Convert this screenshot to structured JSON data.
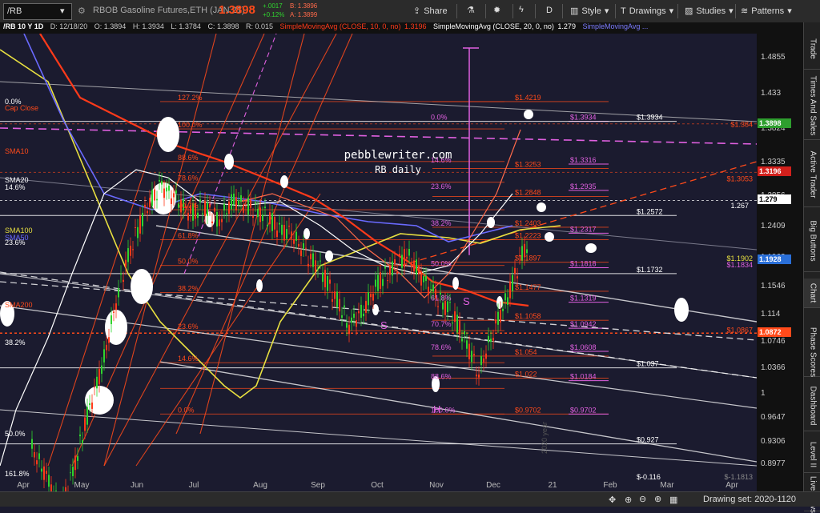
{
  "toolbar": {
    "symbol": "/RB",
    "title": "RBOB Gasoline Futures,ETH (JAN 21)",
    "last": "1.3898",
    "change": "+.0017",
    "change_pct": "+0.12%",
    "bid": "B: 1.3896",
    "ask": "A: 1.3899",
    "share": "Share",
    "period": "D",
    "style": "Style",
    "drawings": "Drawings",
    "studies": "Studies",
    "patterns": "Patterns"
  },
  "header": {
    "symbol_period": "/RB 10 Y 1D",
    "date": "D: 12/18/20",
    "open": "O: 1.3894",
    "high": "H: 1.3934",
    "low": "L: 1.3784",
    "close": "C: 1.3898",
    "range": "R: 0.015",
    "sma10": "SimpleMovingAvg (CLOSE, 10, 0, no)",
    "sma10_val": "1.3196",
    "sma20": "SimpleMovingAvg (CLOSE, 20, 0, no)",
    "sma20_val": "1.279",
    "sma_more": "SimpleMovingAvg ..."
  },
  "price_axis": {
    "ticks": [
      "1.4855",
      "1.433",
      "1.3824",
      "1.3335",
      "1.2856",
      "1.2409",
      "1.1963",
      "1.1546",
      "1.114",
      "1.0746",
      "1.0366",
      "1",
      "0.9647",
      "0.9306",
      "0.8977"
    ],
    "badges": [
      {
        "label": "1.3898",
        "color": "#2e9e2e"
      },
      {
        "label": "1.3196",
        "color": "#d2201c"
      },
      {
        "label": "1.279",
        "color": "#ffffff"
      },
      {
        "label": "1.1928",
        "color": "#2a6fd8"
      },
      {
        "label": "1.0872",
        "color": "#ff4a1a"
      }
    ]
  },
  "x_axis": [
    "Apr",
    "May",
    "Jun",
    "Jul",
    "Aug",
    "Sep",
    "Oct",
    "Nov",
    "Dec",
    "21",
    "Feb",
    "Mar",
    "Apr"
  ],
  "watermark": [
    "pebblewriter.com",
    "RB daily"
  ],
  "year_tag": "2020 year",
  "left_labels": {
    "top": "0.0%",
    "cap": "Cap Close",
    "sma10": "SMA10",
    "sma20": "SMA20",
    "fib146": "14.6%",
    "sma100": "SMA100",
    "sma50": "SMA50",
    "fib236": "23.6%",
    "sma200": "SMA200",
    "fib382": "38.2%",
    "fib50": "50.0%",
    "fib1618": "161.8%"
  },
  "fib_left_pct": [
    "127.2%",
    "100.0%",
    "88.6%",
    "78.6%",
    "70.7%",
    "61.8%",
    "50.0%",
    "38.2%",
    "23.6%",
    "14.6%",
    "0.0%"
  ],
  "fib_mid": {
    "pct": [
      "0.0%",
      "14.6%",
      "23.6%",
      "38.2%",
      "50.0%",
      "61.8%",
      "70.7%",
      "78.6%",
      "88.6%",
      "100.0%"
    ],
    "vals": [
      "$1.4219",
      "$1.3253",
      "$1.2848",
      "$1.2403",
      "$1.2223",
      "$1.1897",
      "$1.1477",
      "$1.1058",
      "$1.054",
      "$1.022",
      "$0.9702"
    ]
  },
  "fib_right": {
    "vals": [
      "$1.3934",
      "$1.3316",
      "$1.2935",
      "$1.2317",
      "$1.1818",
      "$1.1319",
      "$1.0942",
      "$1.0608",
      "$1.0184",
      "$0.9702"
    ]
  },
  "white_vals": [
    "$1.3934",
    "$1.2572",
    "$1.1732",
    "$1.037",
    "$0.927",
    "$-0.116"
  ],
  "far_right": {
    "r1": "$1.384",
    "r2": "$1.3053",
    "r3": "1.267",
    "r4": "$1.1902",
    "r5": "$1.1834",
    "r6": "$1.0867",
    "r7": "$-1.1813"
  },
  "pattern_labels": {
    "s1": "S",
    "s2": "S",
    "h": "H"
  },
  "right_tabs": [
    "Trade",
    "Times And Sales",
    "Active Trader",
    "Big Buttons",
    "Chart",
    "Phase Scores",
    "Dashboard",
    "Level II",
    "Live News"
  ],
  "bottom_bar": {
    "drawing_set": "Drawing set: 2020-1120"
  },
  "colors": {
    "background": "#1b1b2f",
    "fib_orange": "#ff4a1a",
    "fib_magenta": "#e060e0",
    "sma_yellow": "#e8e040",
    "up_green": "#2fd42f",
    "down_red": "#ff3a1a"
  }
}
